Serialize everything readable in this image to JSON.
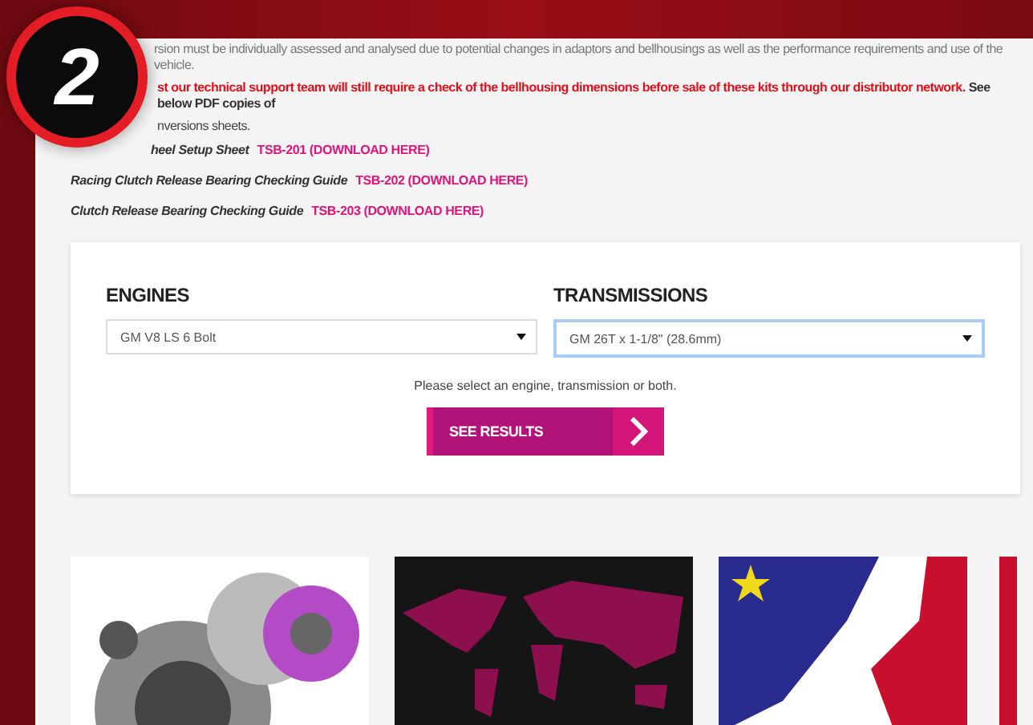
{
  "badge": {
    "number": "2"
  },
  "notes": [
    {
      "text": "rsion must be individually assessed and analysed due to potential changes in adaptors and bellhousings as well as the performance requirements and use of the vehicle."
    },
    {
      "alert": "st our technical support team will still require a check of the bellhousing dimensions before sale of these kits through our distributor network.",
      "text": "See below PDF copies of"
    },
    {
      "text": "nversions sheets."
    }
  ],
  "documents": [
    {
      "name": "heel Setup Sheet",
      "link": "TSB-201 (DOWNLOAD HERE)"
    },
    {
      "name": "Racing Clutch Release Bearing Checking Guide",
      "link": "TSB-202 (DOWNLOAD HERE)"
    },
    {
      "name": "Clutch Release Bearing Checking Guide",
      "link": "TSB-203 (DOWNLOAD HERE)"
    }
  ],
  "selector": {
    "fields": [
      {
        "label": "ENGINES",
        "value": "GM V8 LS 6 Bolt",
        "focused": false
      },
      {
        "label": "TRANSMISSIONS",
        "value": "GM 26T x 1-1/8\" (28.6mm)",
        "focused": true
      }
    ],
    "hint": "Please select an engine, transmission or both.",
    "button": "SEE RESULTS"
  },
  "tiles": [
    {
      "kind": "clutch"
    },
    {
      "kind": "map"
    },
    {
      "kind": "flags"
    }
  ]
}
